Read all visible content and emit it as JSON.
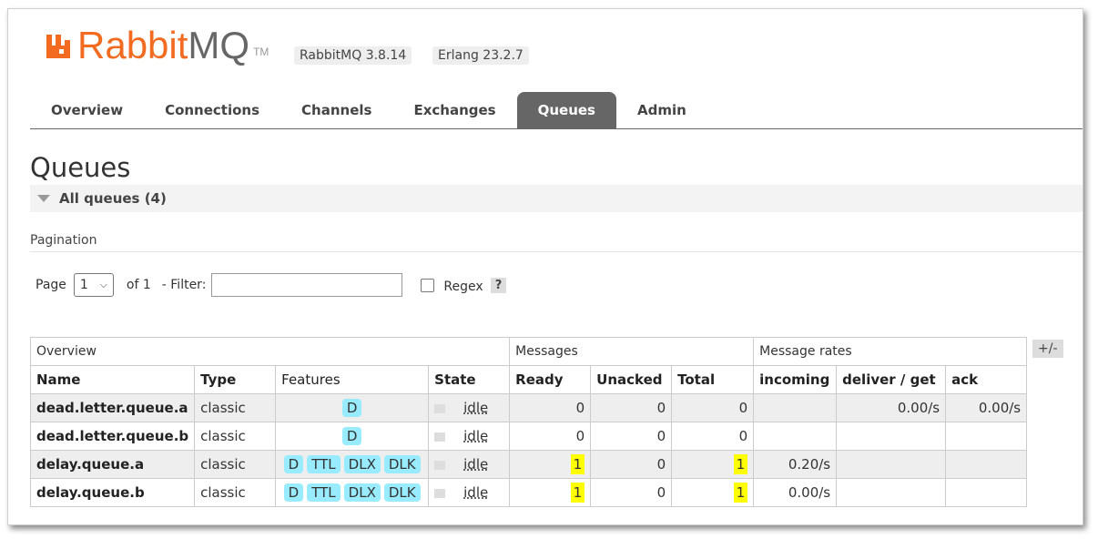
{
  "brand": {
    "name_part1": "Rabbit",
    "name_part2": "MQ",
    "tm": "TM"
  },
  "versions": {
    "rabbitmq": "RabbitMQ 3.8.14",
    "erlang": "Erlang 23.2.7"
  },
  "tabs": [
    {
      "label": "Overview"
    },
    {
      "label": "Connections"
    },
    {
      "label": "Channels"
    },
    {
      "label": "Exchanges"
    },
    {
      "label": "Queues",
      "active": true
    },
    {
      "label": "Admin"
    }
  ],
  "page_title": "Queues",
  "section_title": "All queues (4)",
  "pagination": {
    "label": "Pagination",
    "page_label": "Page",
    "page_value": "1",
    "of_label": "of 1",
    "filter_label": "- Filter:",
    "filter_value": "",
    "regex_label": "Regex",
    "help": "?"
  },
  "table": {
    "groups": {
      "overview": "Overview",
      "messages": "Messages",
      "rates": "Message rates"
    },
    "headers": {
      "name": "Name",
      "type": "Type",
      "features": "Features",
      "state": "State",
      "ready": "Ready",
      "unacked": "Unacked",
      "total": "Total",
      "incoming": "incoming",
      "deliver": "deliver / get",
      "ack": "ack"
    },
    "toggle": "+/-",
    "rows": [
      {
        "name": "dead.letter.queue.a",
        "type": "classic",
        "features": [
          "D"
        ],
        "state": "idle",
        "ready": "0",
        "unacked": "0",
        "total": "0",
        "incoming": "",
        "deliver": "0.00/s",
        "ack": "0.00/s"
      },
      {
        "name": "dead.letter.queue.b",
        "type": "classic",
        "features": [
          "D"
        ],
        "state": "idle",
        "ready": "0",
        "unacked": "0",
        "total": "0",
        "incoming": "",
        "deliver": "",
        "ack": ""
      },
      {
        "name": "delay.queue.a",
        "type": "classic",
        "features": [
          "D",
          "TTL",
          "DLX",
          "DLK"
        ],
        "state": "idle",
        "ready": "1",
        "unacked": "0",
        "total": "1",
        "incoming": "0.20/s",
        "deliver": "",
        "ack": ""
      },
      {
        "name": "delay.queue.b",
        "type": "classic",
        "features": [
          "D",
          "TTL",
          "DLX",
          "DLK"
        ],
        "state": "idle",
        "ready": "1",
        "unacked": "0",
        "total": "1",
        "incoming": "0.00/s",
        "deliver": "",
        "ack": ""
      }
    ]
  },
  "colors": {
    "brand_orange": "#f26b21",
    "active_tab": "#666666",
    "feature_badge": "#99ebff",
    "highlight": "#ffff00"
  }
}
